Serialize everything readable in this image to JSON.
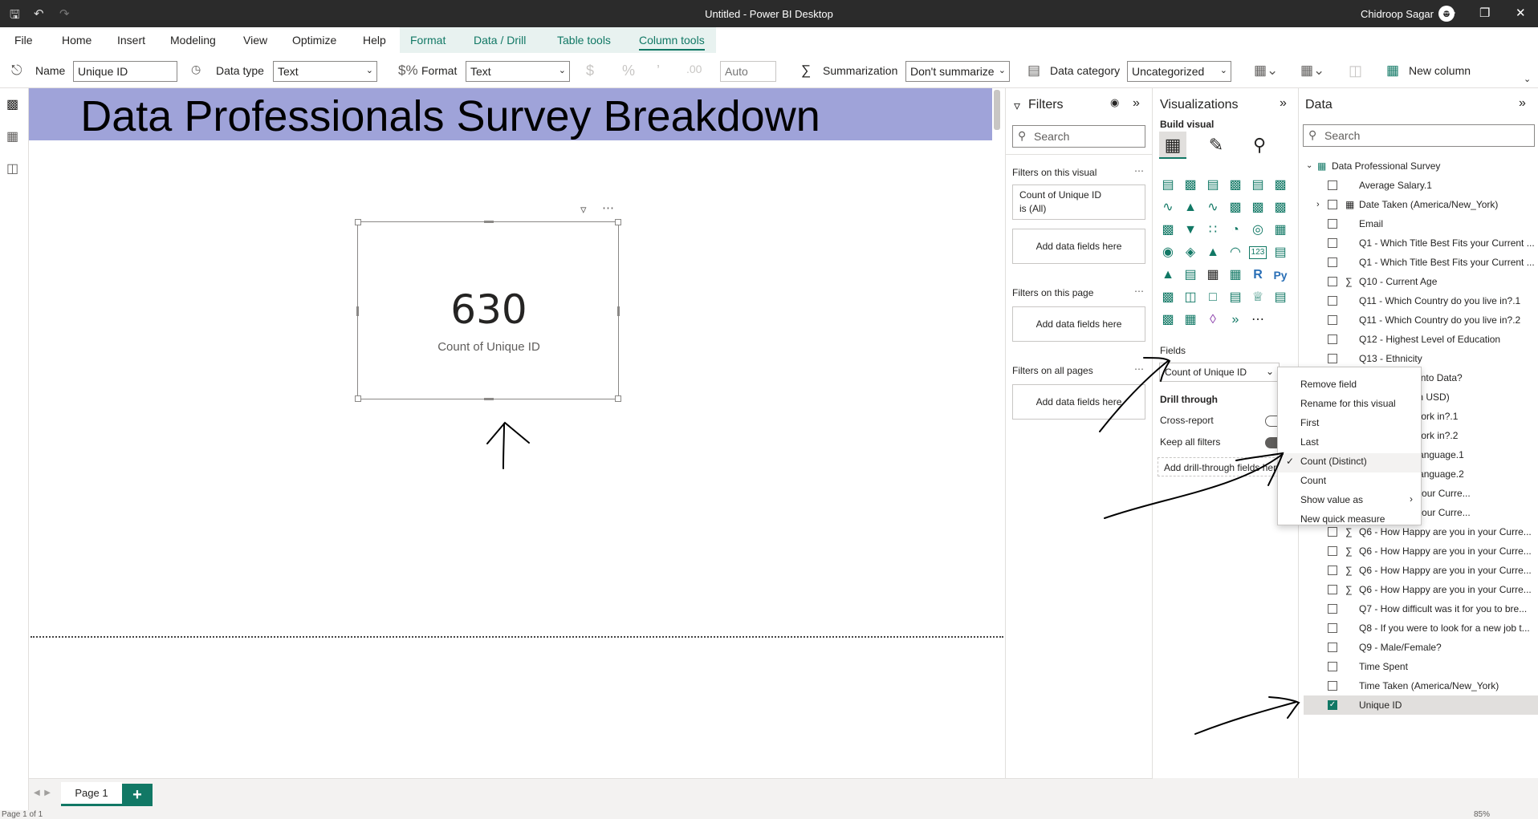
{
  "window": {
    "title": "Untitled - Power BI Desktop",
    "user": "Chidroop Sagar"
  },
  "menu": {
    "items": [
      "File",
      "Home",
      "Insert",
      "Modeling",
      "View",
      "Optimize",
      "Help"
    ],
    "context_items": [
      "Format",
      "Data / Drill",
      "Table tools",
      "Column tools"
    ],
    "active": "Column tools"
  },
  "ribbon": {
    "name_label": "Name",
    "name_value": "Unique ID",
    "datatype_label": "Data type",
    "datatype_value": "Text",
    "format_label": "Format",
    "format_value": "Text",
    "decimal_placeholder": "Auto",
    "summarization_label": "Summarization",
    "summarization_value": "Don't summarize",
    "category_label": "Data category",
    "category_value": "Uncategorized",
    "new_column_label": "New column"
  },
  "canvas": {
    "banner_title": "Data Professionals Survey Breakdown",
    "card_value": "630",
    "card_label": "Count of Unique ID"
  },
  "pages": {
    "tab": "Page 1",
    "status_left": "Page 1 of 1",
    "zoom": "85%"
  },
  "filters": {
    "title": "Filters",
    "search": "Search",
    "on_visual": "Filters on this visual",
    "visual_filter_line1": "Count of Unique ID",
    "visual_filter_line2": "is (All)",
    "add_fields": "Add data fields here",
    "on_page": "Filters on this page",
    "on_all": "Filters on all pages"
  },
  "visualizations": {
    "title": "Visualizations",
    "build": "Build visual",
    "fields_label": "Fields",
    "field_well": "Count of Unique ID",
    "drill_through": "Drill through",
    "cross_report": "Cross-report",
    "keep_filters": "Keep all filters",
    "add_drill": "Add drill-through fields here"
  },
  "context_menu": {
    "items": [
      "Remove field",
      "Rename for this visual",
      "First",
      "Last",
      "Count (Distinct)",
      "Count",
      "Show value as",
      "New quick measure"
    ],
    "checked": "Count (Distinct)"
  },
  "data": {
    "title": "Data",
    "search": "Search",
    "table": "Data Professional Survey",
    "fields": [
      {
        "label": "Average Salary.1",
        "sigma": false,
        "checked": false
      },
      {
        "label": "Date Taken (America/New_York)",
        "sigma": false,
        "checked": false,
        "expandable": true
      },
      {
        "label": "Email",
        "sigma": false,
        "checked": false
      },
      {
        "label": "Q1 - Which Title Best Fits your Current ...",
        "sigma": false,
        "checked": false
      },
      {
        "label": "Q1 - Which Title Best Fits your Current ...",
        "sigma": false,
        "checked": false
      },
      {
        "label": "Q10 - Current Age",
        "sigma": true,
        "checked": false
      },
      {
        "label": "Q11 - Which Country do you live in?.1",
        "sigma": false,
        "checked": false
      },
      {
        "label": "Q11 - Which Country do you live in?.2",
        "sigma": false,
        "checked": false
      },
      {
        "label": "Q12 - Highest Level of Education",
        "sigma": false,
        "checked": false
      },
      {
        "label": "Q13 - Ethnicity",
        "sigma": false,
        "checked": false
      },
      {
        "label": "witch careers into Data?",
        "sigma": false,
        "checked": false
      },
      {
        "label": "early Salary (in USD)",
        "sigma": false,
        "checked": false
      },
      {
        "label": "ustry do you work in?.1",
        "sigma": false,
        "checked": false
      },
      {
        "label": "ustry do you work in?.2",
        "sigma": false,
        "checked": false
      },
      {
        "label": "rogramming Language.1",
        "sigma": false,
        "checked": false
      },
      {
        "label": "rogramming Language.2",
        "sigma": false,
        "checked": false
      },
      {
        "label": "py are you in your Curre...",
        "sigma": false,
        "checked": false
      },
      {
        "label": "py are you in your Curre...",
        "sigma": false,
        "checked": false
      },
      {
        "label": "Q6 - How Happy are you in your Curre...",
        "sigma": true,
        "checked": false
      },
      {
        "label": "Q6 - How Happy are you in your Curre...",
        "sigma": true,
        "checked": false
      },
      {
        "label": "Q6 - How Happy are you in your Curre...",
        "sigma": true,
        "checked": false
      },
      {
        "label": "Q6 - How Happy are you in your Curre...",
        "sigma": true,
        "checked": false
      },
      {
        "label": "Q7 - How difficult was it for you to bre...",
        "sigma": false,
        "checked": false
      },
      {
        "label": "Q8 - If you were to look for a new job t...",
        "sigma": false,
        "checked": false
      },
      {
        "label": "Q9 - Male/Female?",
        "sigma": false,
        "checked": false
      },
      {
        "label": "Time Spent",
        "sigma": false,
        "checked": false
      },
      {
        "label": "Time Taken (America/New_York)",
        "sigma": false,
        "checked": false
      },
      {
        "label": "Unique ID",
        "sigma": false,
        "checked": true
      }
    ]
  },
  "icons": {
    "save": "save-icon",
    "undo": "undo-icon",
    "redo": "redo-icon",
    "filter": "filter-icon",
    "more": "more-options-icon"
  },
  "colors": {
    "accent": "#117865",
    "banner": "#9fa3d9",
    "titlebar": "#2b2b2b"
  }
}
